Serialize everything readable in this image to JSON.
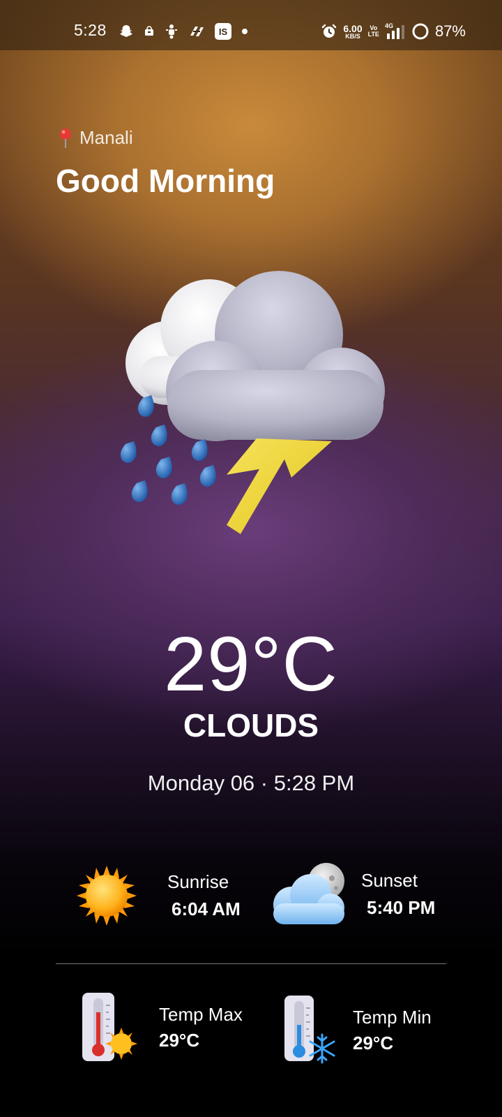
{
  "status_bar": {
    "time": "5:28",
    "net_speed_value": "6.00",
    "net_speed_unit": "KB/S",
    "volte_top": "Vo",
    "volte_bottom": "LTE",
    "signal_label": "4G",
    "battery_percent": "87%"
  },
  "header": {
    "location": "Manali",
    "greeting": "Good Morning"
  },
  "current": {
    "icon": "thunderstorm-cloud-rain-icon",
    "temperature": "29°C",
    "condition": "CLOUDS",
    "datetime": "Monday 06 · 5:28 PM"
  },
  "sun": {
    "sunrise_label": "Sunrise",
    "sunrise_time": "6:04 AM",
    "sunset_label": "Sunset",
    "sunset_time": "5:40 PM"
  },
  "temps": {
    "max_label": "Temp Max",
    "max_value": "29°C",
    "min_label": "Temp Min",
    "min_value": "29°C"
  },
  "colors": {
    "top_glow": "#c98a3a",
    "mid_glow": "#6a3d7a",
    "bottom": "#000000"
  }
}
